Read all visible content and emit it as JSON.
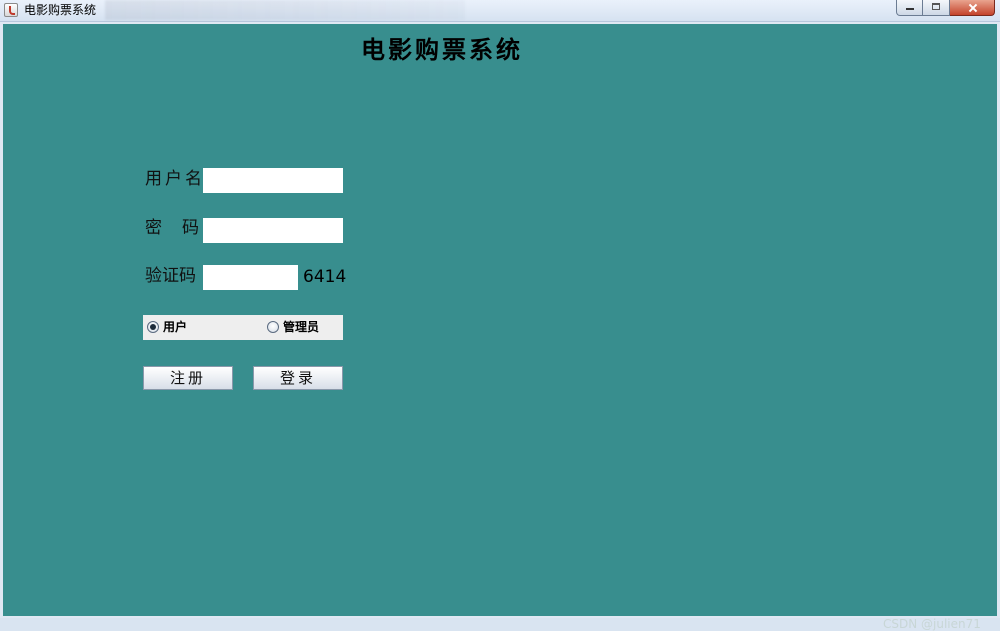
{
  "window": {
    "title": "电影购票系统",
    "app_icon": "java-cup-icon",
    "controls": [
      "minimize-icon",
      "maximize-icon",
      "close-icon"
    ]
  },
  "main": {
    "heading": "电影购票系统",
    "background_color": "#388e8e",
    "username": {
      "label": "用户名",
      "value": ""
    },
    "password": {
      "label_part1": "密",
      "label_part2": "码",
      "value": ""
    },
    "captcha": {
      "label": "验证码",
      "value": "",
      "code": "6414"
    },
    "role": {
      "options": [
        {
          "label": "用户",
          "checked": true
        },
        {
          "label": "管理员",
          "checked": false
        }
      ]
    },
    "buttons": {
      "register": "注册",
      "login": "登录"
    }
  },
  "watermark": "CSDN @julien71"
}
